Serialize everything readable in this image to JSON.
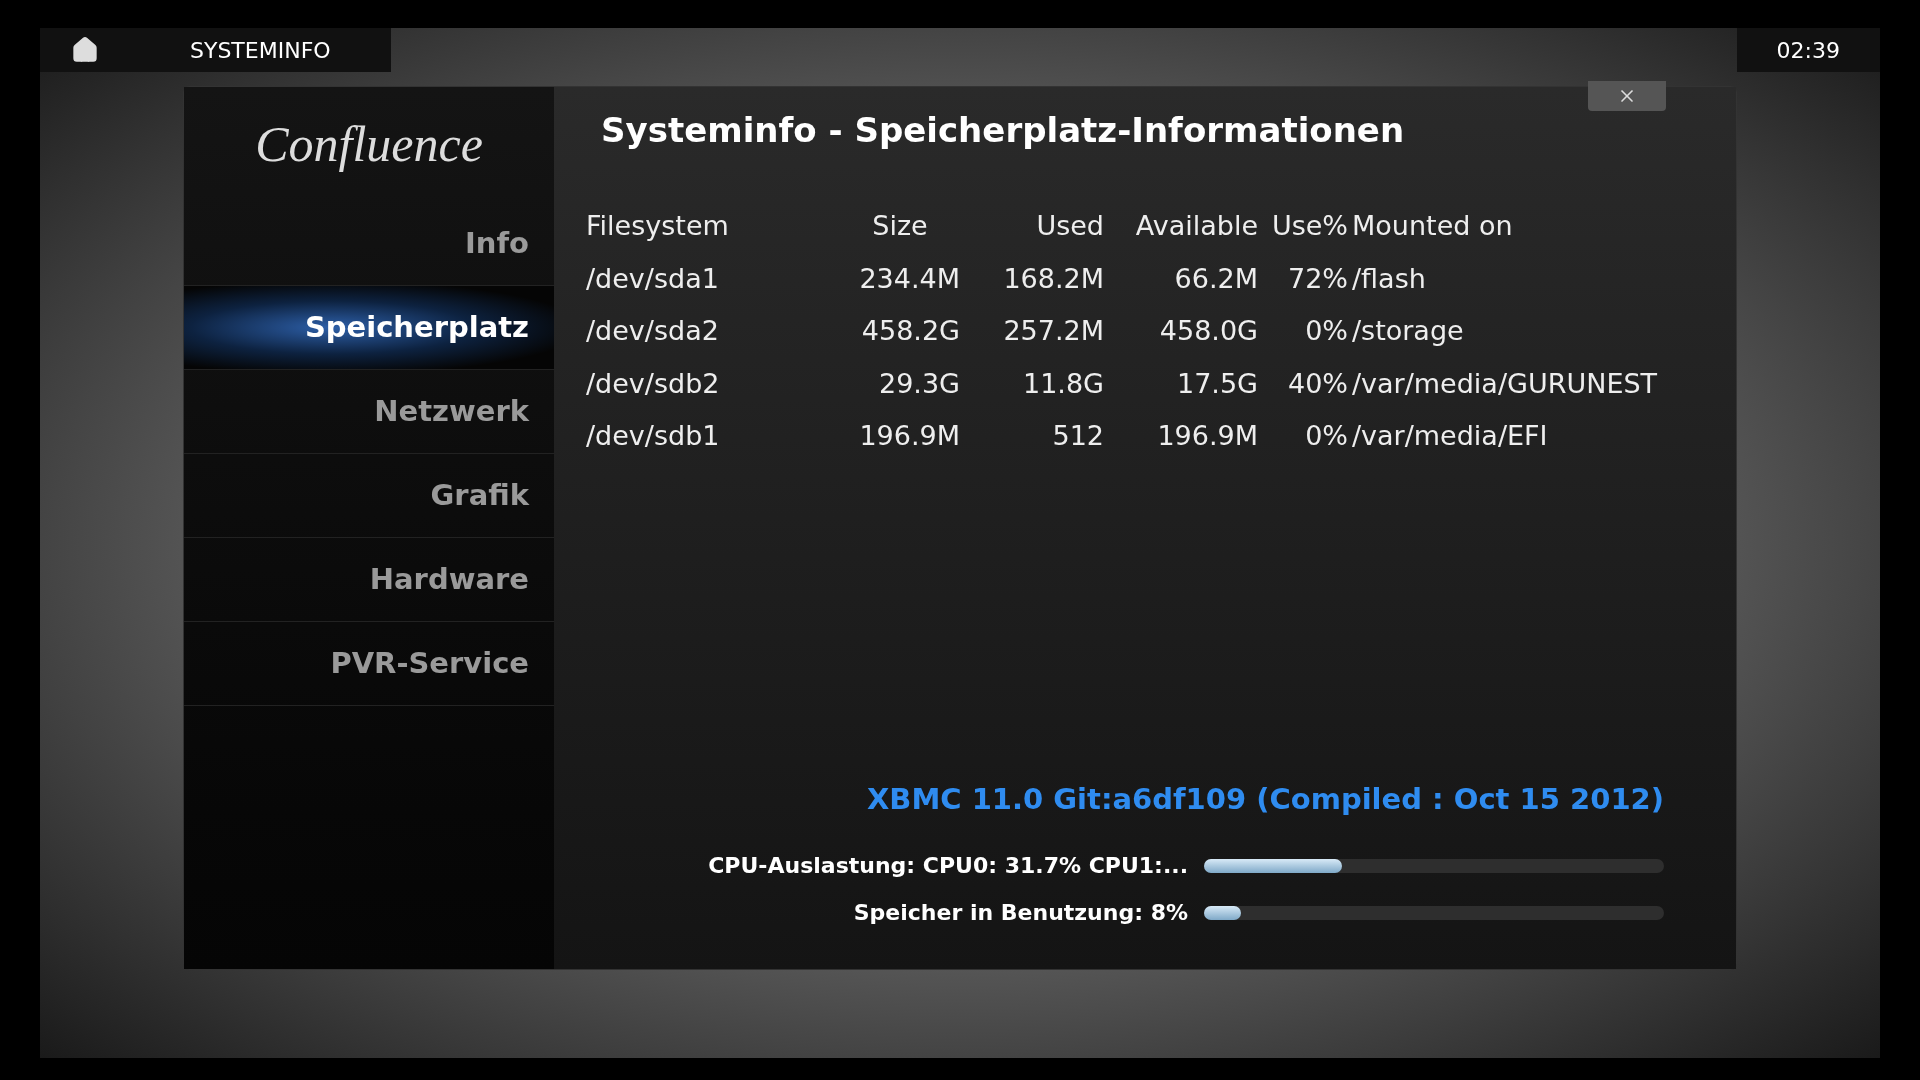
{
  "top_bar": {
    "section_title": "SYSTEMINFO",
    "clock": "02:39"
  },
  "dialog": {
    "title": "Systeminfo - Speicherplatz-Informationen",
    "logo_text": "Confluence"
  },
  "sidebar": {
    "items": [
      {
        "label": "Info",
        "selected": false
      },
      {
        "label": "Speicherplatz",
        "selected": true
      },
      {
        "label": "Netzwerk",
        "selected": false
      },
      {
        "label": "Grafik",
        "selected": false
      },
      {
        "label": "Hardware",
        "selected": false
      },
      {
        "label": "PVR-Service",
        "selected": false
      }
    ]
  },
  "table": {
    "columns": [
      "Filesystem",
      "Size",
      "Used",
      "Available",
      "Use%",
      "Mounted on"
    ],
    "rows": [
      [
        "/dev/sda1",
        "234.4M",
        "168.2M",
        "66.2M",
        "72%",
        "/flash"
      ],
      [
        "/dev/sda2",
        "458.2G",
        "257.2M",
        "458.0G",
        "0%",
        "/storage"
      ],
      [
        "/dev/sdb2",
        "29.3G",
        "11.8G",
        "17.5G",
        "40%",
        "/var/media/GURUNEST"
      ],
      [
        "/dev/sdb1",
        "196.9M",
        "512",
        "196.9M",
        "0%",
        "/var/media/EFI"
      ]
    ]
  },
  "version": "XBMC 11.0 Git:a6df109 (Compiled : Oct 15 2012)",
  "meters": [
    {
      "label": "CPU-Auslastung: CPU0: 31.7% CPU1:...",
      "level": 0.3
    },
    {
      "label": "Speicher in Benutzung: 8%",
      "level": 0.08
    }
  ]
}
